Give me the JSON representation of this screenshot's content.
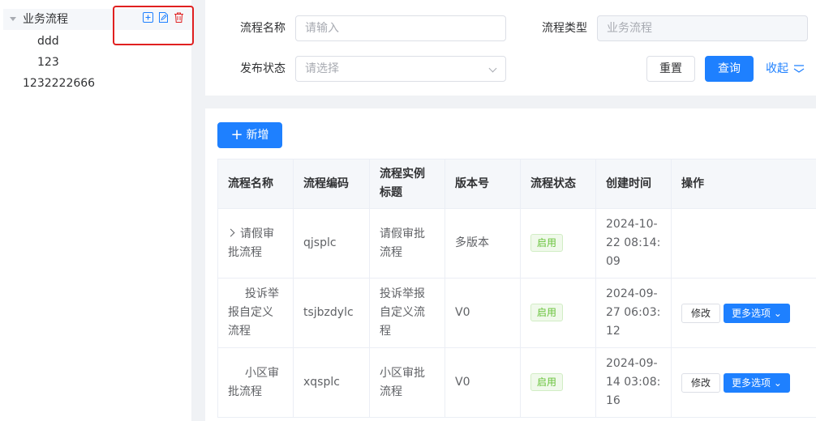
{
  "sidebar": {
    "tree": [
      {
        "label": "业务流程",
        "children": [
          {
            "label": "ddd"
          },
          {
            "label": "123"
          }
        ]
      },
      {
        "label": "1232222666"
      }
    ],
    "actions": [
      "add-node-icon",
      "edit-node-icon",
      "delete-node-icon"
    ]
  },
  "filter": {
    "name_label": "流程名称",
    "name_placeholder": "请输入",
    "type_label": "流程类型",
    "type_value": "业务流程",
    "status_label": "发布状态",
    "status_placeholder": "请选择",
    "reset_label": "重置",
    "query_label": "查询",
    "collapse_label": "收起"
  },
  "toolbar": {
    "add_label": "新增"
  },
  "table": {
    "headers": [
      "流程名称",
      "流程编码",
      "流程实例标题",
      "版本号",
      "流程状态",
      "创建时间",
      "操作"
    ],
    "rows": [
      {
        "name": "请假审批流程",
        "code": "qjsplc",
        "title": "请假审批流程",
        "version": "多版本",
        "status": "启用",
        "created": "2024-10-22 08:14:09",
        "expandable": true,
        "actions": []
      },
      {
        "name": "投诉举报自定义流程",
        "code": "tsjbzdylc",
        "title": "投诉举报自定义流程",
        "version": "V0",
        "status": "启用",
        "created": "2024-09-27 06:03:12",
        "expandable": false,
        "actions": [
          "修改",
          "更多选项"
        ]
      },
      {
        "name": "小区审批流程",
        "code": "xqsplc",
        "title": "小区审批流程",
        "version": "V0",
        "status": "启用",
        "created": "2024-09-14 03:08:16",
        "expandable": false,
        "actions": [
          "修改",
          "更多选项"
        ]
      }
    ]
  },
  "colors": {
    "primary": "#1e80ff",
    "highlight": "#e02020",
    "success": "#67c23a"
  }
}
